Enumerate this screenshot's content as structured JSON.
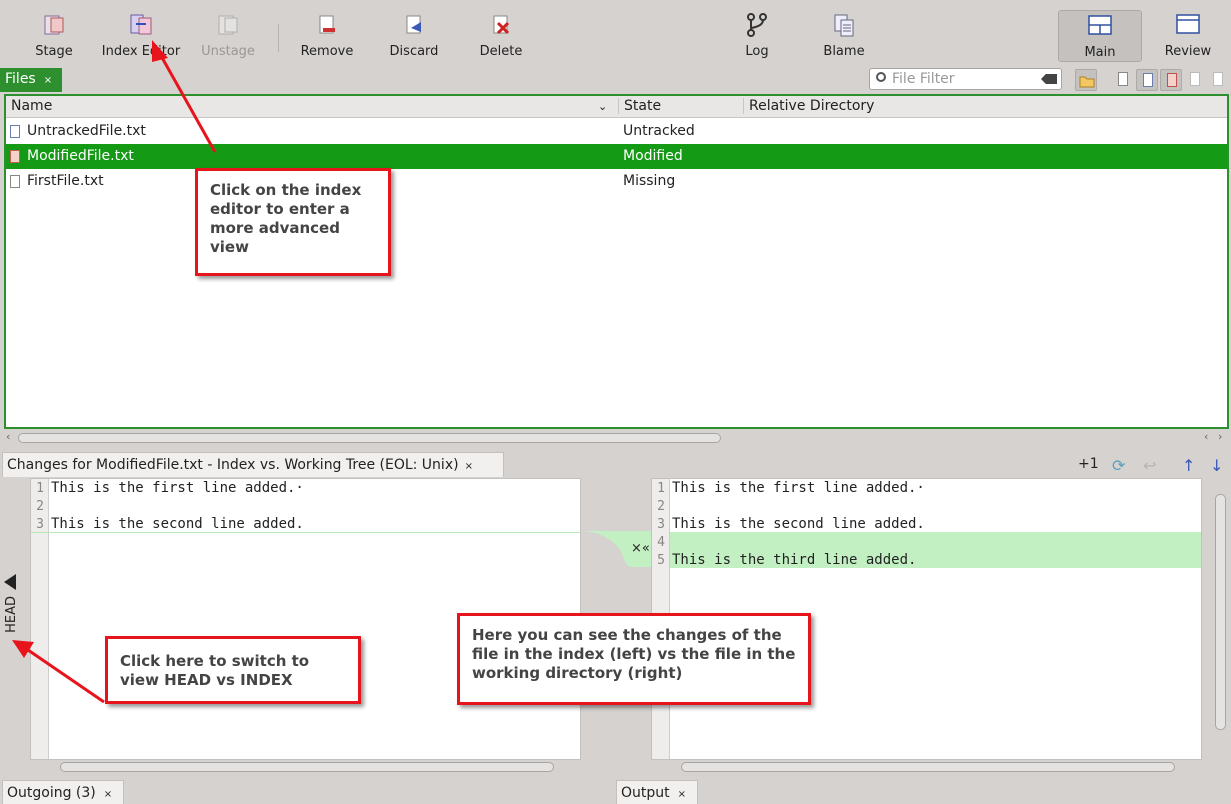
{
  "toolbar": {
    "stage": "Stage",
    "index_editor": "Index Editor",
    "unstage": "Unstage",
    "remove": "Remove",
    "discard": "Discard",
    "delete": "Delete",
    "log": "Log",
    "blame": "Blame",
    "main": "Main",
    "review": "Review"
  },
  "files_tab": {
    "label": "Files",
    "close": "×"
  },
  "filter": {
    "placeholder": "File Filter"
  },
  "file_table": {
    "columns": [
      "Name",
      "State",
      "Relative Directory"
    ],
    "rows": [
      {
        "name": "UntrackedFile.txt",
        "state": "Untracked",
        "dir": ""
      },
      {
        "name": "ModifiedFile.txt",
        "state": "Modified",
        "dir": ""
      },
      {
        "name": "FirstFile.txt",
        "state": "Missing",
        "dir": ""
      }
    ]
  },
  "changes": {
    "tab_label": "Changes for ModifiedFile.txt - Index vs. Working Tree (EOL: Unix)",
    "close": "×",
    "count": "+1",
    "head_label": "HEAD",
    "left_lines": [
      {
        "n": "1",
        "text": "This is the first line added.·"
      },
      {
        "n": "2",
        "text": ""
      },
      {
        "n": "3",
        "text": "This is the second line added."
      }
    ],
    "right_lines": [
      {
        "n": "1",
        "text": "This is the first line added.·"
      },
      {
        "n": "2",
        "text": ""
      },
      {
        "n": "3",
        "text": "This is the second line added."
      },
      {
        "n": "4",
        "text": ""
      },
      {
        "n": "5",
        "text": "This is the third line added."
      }
    ],
    "merge_controls": "×«"
  },
  "bottom_tabs": {
    "outgoing": "Outgoing (3)",
    "output": "Output",
    "close": "×"
  },
  "callouts": {
    "index_editor": "Click on the index editor to enter a more advanced view",
    "head": "Click here to switch to view HEAD vs INDEX",
    "changes": "Here you can see the changes of the file in the index (left) vs the file in the working directory (right)"
  },
  "colors": {
    "accent_green": "#2e8f2e",
    "selection_green": "#149a14",
    "added_line": "#c3f0c3",
    "callout_red": "#e8141c"
  }
}
